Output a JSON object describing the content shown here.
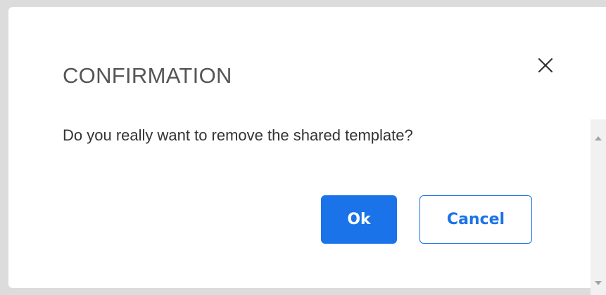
{
  "dialog": {
    "title": "CONFIRMATION",
    "message": "Do you really want to remove the shared template?",
    "ok_label": "Ok",
    "cancel_label": "Cancel",
    "close_icon": "close-icon"
  },
  "colors": {
    "accent": "#1a73e8",
    "title": "#555555",
    "text": "#333333",
    "backdrop": "#dcdcdc"
  }
}
